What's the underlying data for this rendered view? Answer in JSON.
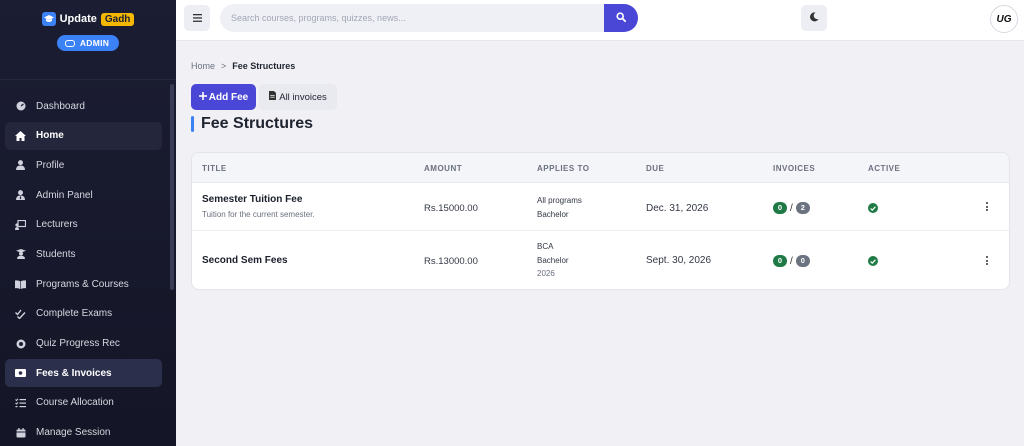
{
  "brand": {
    "name": "Update",
    "tag": "Gadh",
    "role": "ADMIN"
  },
  "sidebar": {
    "items": [
      {
        "label": "Dashboard",
        "icon": "dashboard-icon"
      },
      {
        "label": "Home",
        "icon": "home-icon"
      },
      {
        "label": "Profile",
        "icon": "user-icon"
      },
      {
        "label": "Admin Panel",
        "icon": "user-tie-icon"
      },
      {
        "label": "Lecturers",
        "icon": "chalkboard-teacher-icon"
      },
      {
        "label": "Students",
        "icon": "graduate-icon"
      },
      {
        "label": "Programs & Courses",
        "icon": "book-icon"
      },
      {
        "label": "Complete Exams",
        "icon": "check-double-icon"
      },
      {
        "label": "Quiz Progress Rec",
        "icon": "record-icon"
      },
      {
        "label": "Fees & Invoices",
        "icon": "money-icon"
      },
      {
        "label": "Course Allocation",
        "icon": "list-check-icon"
      },
      {
        "label": "Manage Session",
        "icon": "calendar-icon"
      }
    ]
  },
  "topbar": {
    "search_placeholder": "Search courses, programs, quizzes, news...",
    "avatar_initials": "UG"
  },
  "breadcrumb": {
    "home": "Home",
    "separator": ">",
    "current": "Fee Structures"
  },
  "actions": {
    "add_fee": "Add Fee",
    "all_invoices": "All invoices"
  },
  "page": {
    "title": "Fee Structures"
  },
  "table": {
    "columns": [
      "TITLE",
      "AMOUNT",
      "APPLIES TO",
      "DUE",
      "INVOICES",
      "ACTIVE"
    ],
    "rows": [
      {
        "title": "Semester Tuition Fee",
        "subtitle": "Tuition for the current semester.",
        "amount": "Rs.15000.00",
        "applies": [
          "All programs",
          "Bachelor"
        ],
        "due": "Dec. 31, 2026",
        "invoices_paid": "0",
        "invoices_total": "2",
        "active": true
      },
      {
        "title": "Second Sem Fees",
        "subtitle": "",
        "amount": "Rs.13000.00",
        "applies": [
          "BCA",
          "Bachelor",
          "2026"
        ],
        "due": "Sept. 30, 2026",
        "invoices_paid": "0",
        "invoices_total": "0",
        "active": true
      }
    ]
  },
  "colors": {
    "accent": "#4b47d6",
    "sidebar_bg": "#1b1d33",
    "brand_tag": "#f5b800",
    "success": "#1f7a45",
    "info": "#3b82f6"
  }
}
